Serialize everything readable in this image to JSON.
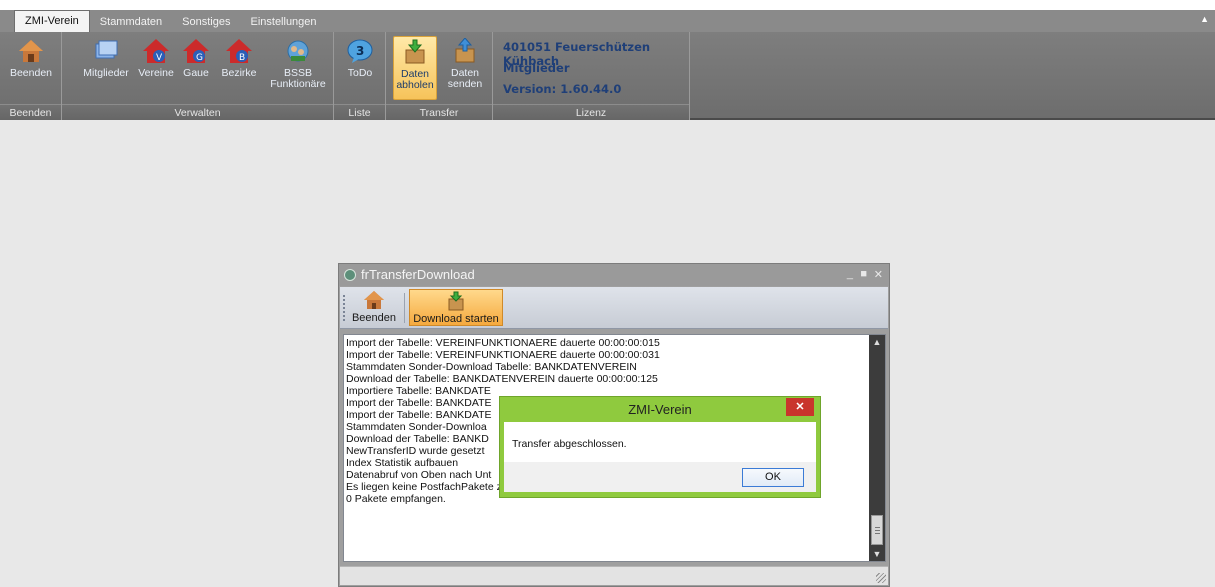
{
  "tabs": [
    "ZMI-Verein",
    "Stammdaten",
    "Sonstiges",
    "Einstellungen"
  ],
  "ribbon": {
    "buttons": {
      "beenden": "Beenden",
      "mitglieder": "Mitglieder",
      "vereine": "Vereine",
      "gaue": "Gaue",
      "bezirke": "Bezirke",
      "bssb_line1": "BSSB",
      "bssb_line2": "Funktionäre",
      "todo": "ToDo",
      "daten_abholen_line1": "Daten",
      "daten_abholen_line2": "abholen",
      "daten_senden_line1": "Daten",
      "daten_senden_line2": "senden"
    },
    "groups": {
      "beenden": "Beenden",
      "verwalten": "Verwalten",
      "liste": "Liste",
      "transfer": "Transfer",
      "lizenz": "Lizenz"
    },
    "license": {
      "line1": "401051 Feuerschützen Kühbach",
      "line2": "Mitglieder",
      "line3": "Version: 1.60.44.0"
    },
    "todo_badge": "3"
  },
  "dialog": {
    "title": "frTransferDownload",
    "toolbar": {
      "beenden": "Beenden",
      "download": "Download starten"
    },
    "log": [
      "Import der Tabelle: VEREINFUNKTIONAERE dauerte 00:00:00:015",
      "Import der Tabelle: VEREINFUNKTIONAERE dauerte 00:00:00:031",
      "Stammdaten Sonder-Download Tabelle: BANKDATENVEREIN",
      "Download der Tabelle: BANKDATENVEREIN dauerte 00:00:00:125",
      "Importiere Tabelle: BANKDATE",
      "Import der Tabelle: BANKDATE",
      "Import der Tabelle: BANKDATE",
      "Stammdaten Sonder-Downloa",
      "Download der Tabelle: BANKD",
      "NewTransferID wurde gesetzt",
      "Index Statistik aufbauen",
      "Datenabruf von Oben nach Unt",
      "Es liegen keine PostfachPakete zum Download bereit",
      "0 Pakete empfangen."
    ]
  },
  "messagebox": {
    "title": "ZMI-Verein",
    "message": "Transfer abgeschlossen.",
    "ok": "OK"
  },
  "colors": {
    "ribbon_bg": "#7a7a7a",
    "license_text": "#1f3f78",
    "msg_frame": "#8fca3e",
    "msg_close": "#c9352c",
    "highlight": "#f6c35a"
  }
}
